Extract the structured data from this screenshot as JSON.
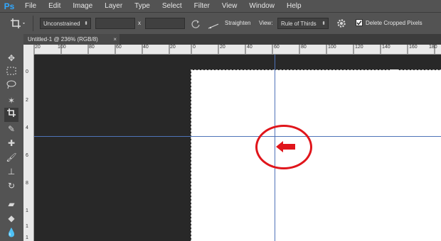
{
  "app": {
    "logo": "Ps"
  },
  "menu": [
    "File",
    "Edit",
    "Image",
    "Layer",
    "Type",
    "Select",
    "Filter",
    "View",
    "Window",
    "Help"
  ],
  "options": {
    "ratio_select": "Unconstrained",
    "ratio_separator": "x",
    "straighten_label": "Straighten",
    "view_label": "View:",
    "view_select": "Rule of Thirds",
    "delete_cropped_label": "Delete Cropped Pixels",
    "delete_cropped_checked": true
  },
  "document": {
    "tab_title": "Untitled-1 @ 236% (RGB/8)",
    "tab_close": "×"
  },
  "ruler_top_labels": [
    "20",
    "100",
    "80",
    "60",
    "40",
    "20",
    "0",
    "20",
    "40",
    "60",
    "80",
    "100",
    "120",
    "140",
    "160",
    "180"
  ],
  "ruler_left_labels": [
    "0",
    "2",
    "4",
    "6",
    "8",
    "1",
    "1",
    "1"
  ],
  "colors": {
    "guide": "#4f73b8",
    "annotation": "#e0151b",
    "ps_blue": "#31a8ff"
  },
  "icons": [
    "crop-icon",
    "move-icon",
    "marquee-icon",
    "lasso-icon",
    "magic-wand-icon",
    "eyedropper-icon",
    "healing-brush-icon",
    "brush-icon",
    "clone-stamp-icon",
    "history-brush-icon",
    "eraser-icon",
    "paint-bucket-icon",
    "blur-icon",
    "gear-icon",
    "reset-icon",
    "straighten-icon",
    "checkbox-icon",
    "arrow-annotation-icon"
  ]
}
